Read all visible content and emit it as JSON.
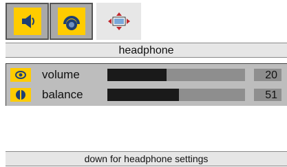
{
  "tabs": [
    {
      "icon": "speaker-icon",
      "selected": false
    },
    {
      "icon": "headphone-icon",
      "selected": true
    },
    {
      "icon": "picture-adjust-icon",
      "selected": false
    }
  ],
  "header": {
    "title": "headphone"
  },
  "settings": [
    {
      "label": "volume",
      "value": "20",
      "level": 0.43,
      "icon": "volume-icon"
    },
    {
      "label": "balance",
      "value": "51",
      "level": 0.52,
      "icon": "balance-icon"
    }
  ],
  "footer": {
    "hint": "down for headphone settings"
  },
  "colors": {
    "accent": "#ffcc00",
    "tab_active_bg": "#a9a9a9",
    "panel_bg": "#bdbdbd",
    "track": "#8e8e8e",
    "fill": "#1a1a1a"
  }
}
